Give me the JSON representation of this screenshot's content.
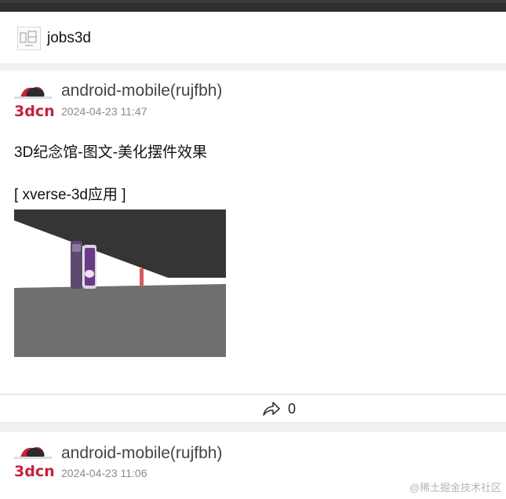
{
  "account": {
    "name": "jobs3d",
    "logo_icon": "jobs3d-logo-icon"
  },
  "posts": [
    {
      "avatar_text": "3dcn",
      "author": "android-mobile(rujfbh)",
      "time": "2024-04-23 11:47",
      "title": "3D纪念馆-图文-美化摆件效果",
      "tag": "[ xverse-3d应用 ]",
      "share_count": "0"
    },
    {
      "avatar_text": "3dcn",
      "author": "android-mobile(rujfbh)",
      "time": "2024-04-23 11:06"
    }
  ],
  "watermark": "@稀土掘金技术社区",
  "colors": {
    "topbar": "#2f2f2f",
    "avatar_red": "#c8213a",
    "background": "#f4f4f4"
  }
}
